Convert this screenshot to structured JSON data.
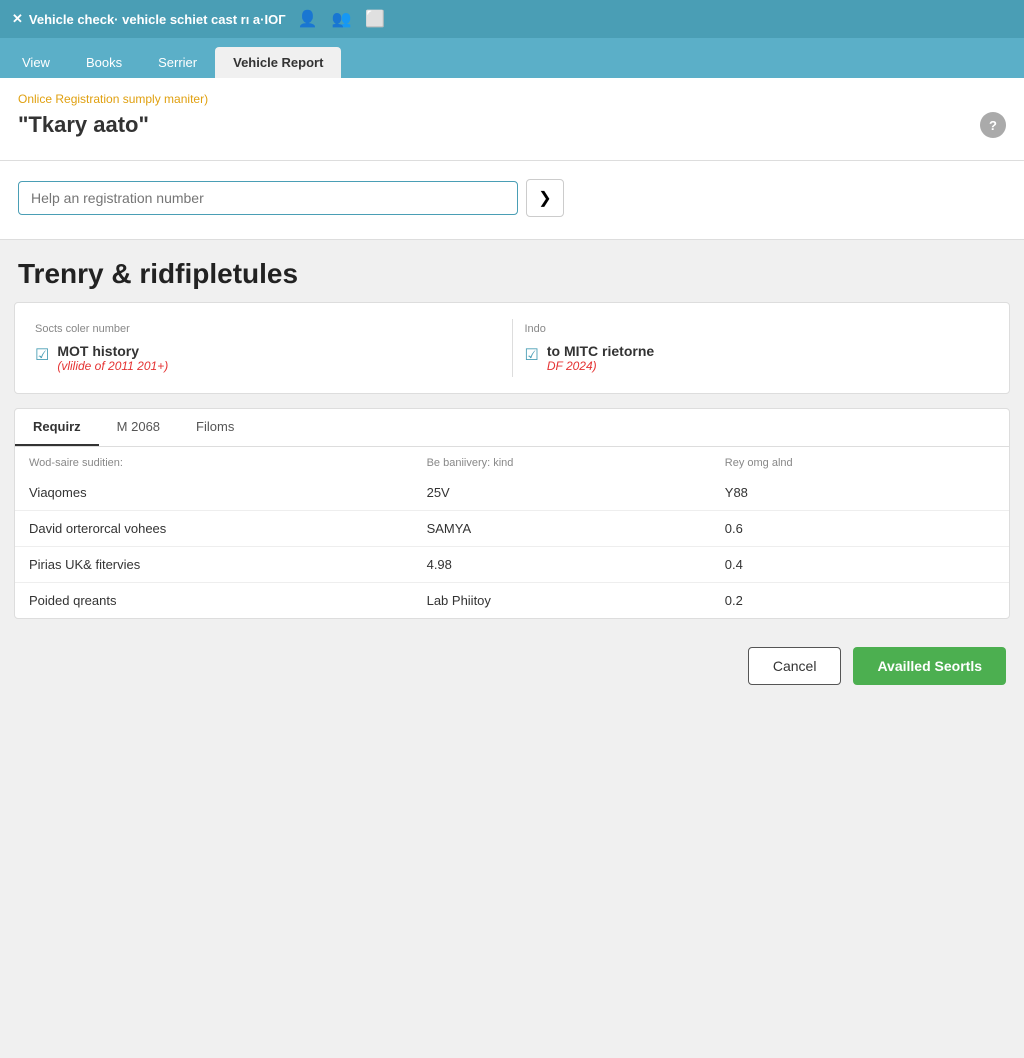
{
  "topbar": {
    "logo": "✕",
    "title": "Vehicle check· vehicle schiet cast rı a·IOГ",
    "icon_user": "👤",
    "icon_group": "👥",
    "icon_window": "⬜"
  },
  "tabs": [
    {
      "label": "View",
      "active": false
    },
    {
      "label": "Books",
      "active": false
    },
    {
      "label": "Serrier",
      "active": false
    },
    {
      "label": "Vehicle Report",
      "active": true
    }
  ],
  "card": {
    "subtitle": "Onlice Registration sumply maniter)",
    "title": "\"Tkary aato\""
  },
  "search": {
    "placeholder": "Help an registration number",
    "button_label": "❯"
  },
  "section_heading": "Trenry & ridfipletules",
  "checks": {
    "col1_label": "Socts coler number",
    "col2_label": "Indo",
    "item1_title": "MOT history",
    "item1_sub": "(vlilide of 2011 201+)",
    "item2_title": "to MITC rietorne",
    "item2_sub": "DF 2024)"
  },
  "inner_tabs": [
    {
      "label": "Requirz",
      "active": true
    },
    {
      "label": "M 2068",
      "active": false
    },
    {
      "label": "Filoms",
      "active": false
    }
  ],
  "table": {
    "headers": [
      "Wod-saire suditien:",
      "Be baniivery: kind",
      "Rey omg alnd"
    ],
    "rows": [
      {
        "col1": "Viaqomes",
        "col2": "25V",
        "col3": "Y88"
      },
      {
        "col1": "David orterorcal vohees",
        "col2": "SAMYA",
        "col3": "0.6"
      },
      {
        "col1": "Pirias UK& fitervies",
        "col2": "4.98",
        "col3": "0.4"
      },
      {
        "col1": "Poided qreants",
        "col2": "Lab Phiitoy",
        "col3": "0.2"
      }
    ]
  },
  "buttons": {
    "cancel": "Cancel",
    "primary": "Availled Seortls"
  }
}
